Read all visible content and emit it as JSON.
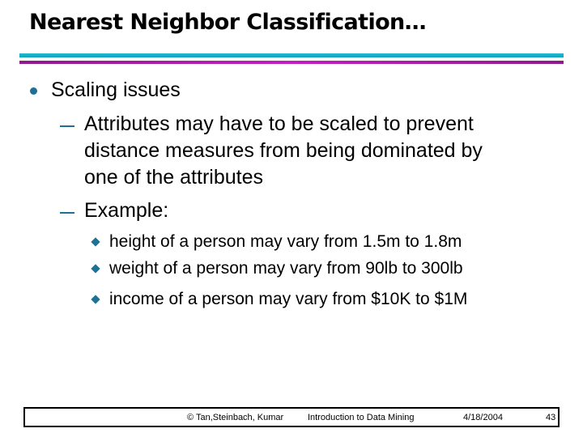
{
  "slide": {
    "title": "Nearest Neighbor Classification…",
    "colors": {
      "accent_cyan": "#1eb8cf",
      "accent_magenta": "#b81eb5",
      "bullet": "#1f6e96"
    },
    "bullets": [
      {
        "level": 1,
        "icon": "dot-bullet-icon",
        "text": "Scaling issues",
        "children": [
          {
            "level": 2,
            "icon": "dash-bullet-icon",
            "lines": [
              "Attributes may have to be scaled to prevent",
              "distance measures from being dominated by",
              "one of the attributes"
            ]
          },
          {
            "level": 2,
            "icon": "dash-bullet-icon",
            "lines": [
              "Example:"
            ],
            "children": [
              {
                "level": 3,
                "icon": "diamond-bullet-icon",
                "text": "height of a person may vary from 1.5m to 1.8m"
              },
              {
                "level": 3,
                "icon": "diamond-bullet-icon",
                "text": "weight of a person may vary from 90lb to 300lb"
              },
              {
                "level": 3,
                "icon": "diamond-bullet-icon",
                "text": "income of a person may vary from $10K to $1M"
              }
            ]
          }
        ]
      }
    ]
  },
  "footer": {
    "copyright": "© Tan,Steinbach, Kumar",
    "course": "Introduction to Data Mining",
    "date": "4/18/2004",
    "page_number": "43"
  }
}
